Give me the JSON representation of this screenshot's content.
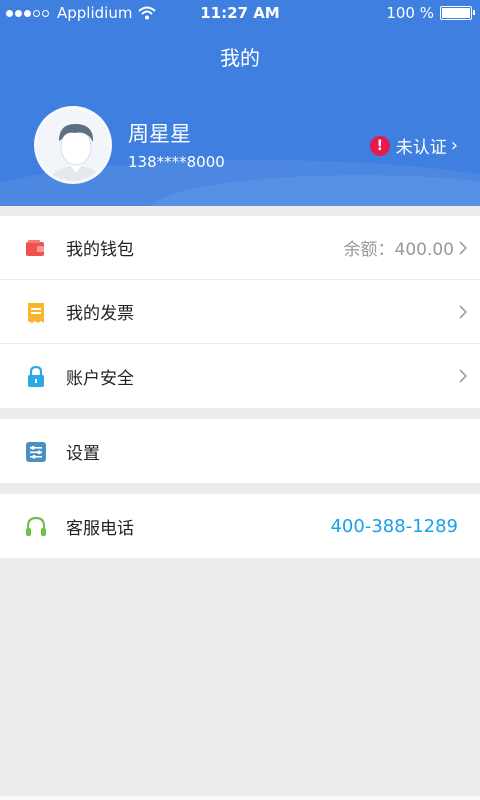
{
  "status_bar": {
    "carrier": "Applidium",
    "time": "11:27 AM",
    "battery": "100 %"
  },
  "header": {
    "title": "我的",
    "user": {
      "name": "周星星",
      "phone": "138****8000",
      "verify_label": "未认证",
      "verify_icon": "exclamation"
    }
  },
  "menu": {
    "wallet": {
      "label": "我的钱包",
      "value": "余额：400.00",
      "icon": "wallet-icon",
      "color": "#ef5350"
    },
    "invoice": {
      "label": "我的发票",
      "icon": "invoice-icon",
      "color": "#f8b62d"
    },
    "security": {
      "label": "账户安全",
      "icon": "lock-icon",
      "color": "#29a9e6"
    },
    "settings": {
      "label": "设置",
      "icon": "settings-icon",
      "color": "#4a90c2"
    },
    "support": {
      "label": "客服电话",
      "value": "400-388-1289",
      "icon": "headset-icon",
      "color": "#6cc24a"
    }
  }
}
